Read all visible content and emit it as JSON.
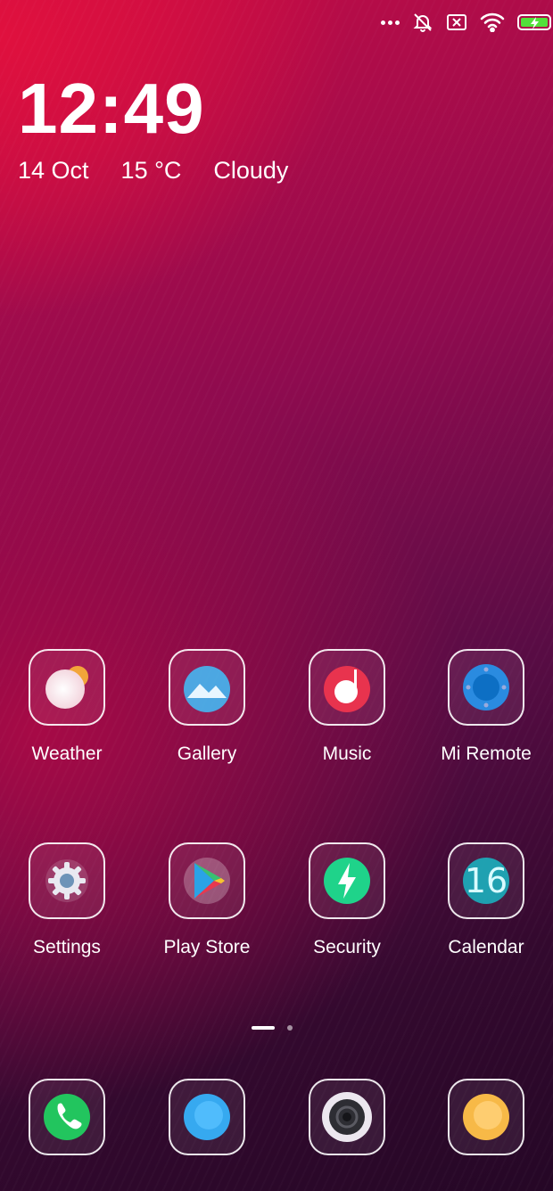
{
  "status_bar": {
    "icons": [
      "more-dots-icon",
      "alarm-off-icon",
      "sim-card-x-icon",
      "wifi-icon",
      "battery-charging-icon"
    ],
    "battery_color": "#52e03a"
  },
  "lock_widget": {
    "time": "12:49",
    "date": "14 Oct",
    "temperature": "15 °C",
    "condition": "Cloudy"
  },
  "apps": [
    {
      "label": "Weather",
      "icon": "weather-icon"
    },
    {
      "label": "Gallery",
      "icon": "gallery-icon"
    },
    {
      "label": "Music",
      "icon": "music-icon"
    },
    {
      "label": "Mi Remote",
      "icon": "mi-remote-icon"
    },
    {
      "label": "Settings",
      "icon": "settings-gear-icon"
    },
    {
      "label": "Play Store",
      "icon": "play-store-icon"
    },
    {
      "label": "Security",
      "icon": "security-bolt-icon"
    },
    {
      "label": "Calendar",
      "icon": "calendar-icon",
      "badge": "16"
    }
  ],
  "dock": [
    {
      "icon": "phone-icon"
    },
    {
      "icon": "messages-icon"
    },
    {
      "icon": "camera-icon"
    },
    {
      "icon": "browser-icon"
    }
  ],
  "page_indicator": {
    "pages": 2,
    "current": 1
  },
  "colors": {
    "background_top": "#e0103e",
    "background_bottom": "#250726",
    "security_green": "#1fd38a",
    "calendar_teal": "#17b8c4",
    "phone_green": "#22c55e"
  }
}
